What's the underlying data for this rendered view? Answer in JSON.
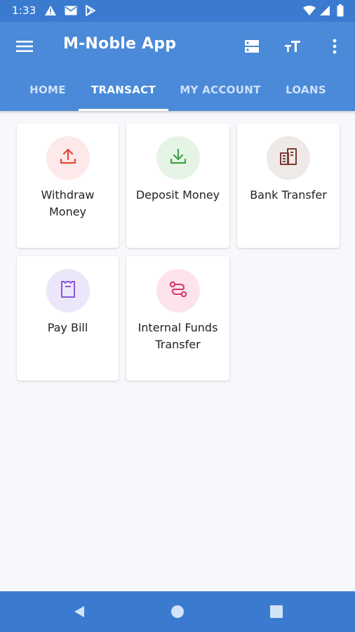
{
  "status_bar": {
    "time": "1:33",
    "icons": [
      "warning-icon",
      "mail-icon",
      "play-store-icon",
      "wifi-icon",
      "signal-icon",
      "battery-icon"
    ]
  },
  "app_bar": {
    "title": "M-Noble App",
    "actions": [
      "menu-icon",
      "dns-icon",
      "text-size-icon",
      "more-vert-icon"
    ],
    "tabs": [
      {
        "label": "HOME",
        "active": false
      },
      {
        "label": "TRANSACT",
        "active": true
      },
      {
        "label": "MY ACCOUNT",
        "active": false
      },
      {
        "label": "LOANS",
        "active": false
      }
    ]
  },
  "cards": [
    {
      "label": "Withdraw Money",
      "icon": "upload-icon",
      "icon_color": "#e5483b",
      "bg_color": "#fde9e9"
    },
    {
      "label": "Deposit Money",
      "icon": "download-icon",
      "icon_color": "#3fa24a",
      "bg_color": "#e6f4e6"
    },
    {
      "label": "Bank Transfer",
      "icon": "bank-document-icon",
      "icon_color": "#7a3b33",
      "bg_color": "#efe9e7"
    },
    {
      "label": "Pay Bill",
      "icon": "bill-icon",
      "icon_color": "#8a57d6",
      "bg_color": "#ece6fa"
    },
    {
      "label": "Internal Funds Transfer",
      "icon": "transfer-icon",
      "icon_color": "#d6336c",
      "bg_color": "#fde4ec"
    }
  ],
  "nav_bar": {
    "buttons": [
      "back-icon",
      "home-icon",
      "recents-icon"
    ]
  },
  "colors": {
    "status_bar": "#3a7bd0",
    "app_bar": "#4a8ad8",
    "background": "#f7f8fc"
  }
}
